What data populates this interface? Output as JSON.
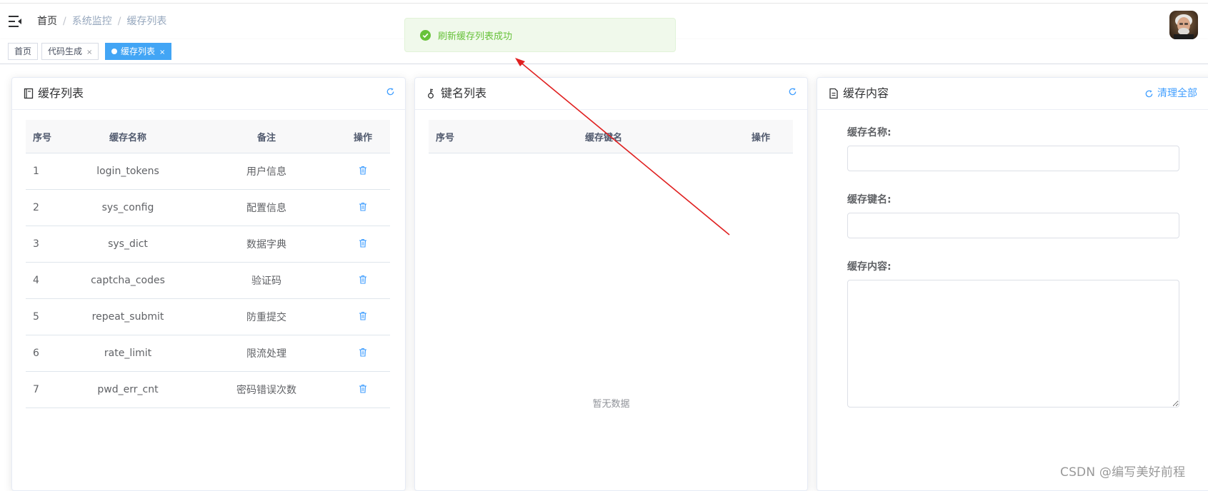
{
  "navbar": {
    "breadcrumb": [
      "首页",
      "系统监控",
      "缓存列表"
    ],
    "breadcrumb_sep": "/"
  },
  "tags": [
    {
      "label": "首页"
    },
    {
      "label": "代码生成",
      "close": "×"
    },
    {
      "label": "缓存列表",
      "close": "×",
      "active": true
    }
  ],
  "toast": {
    "message": "刷新缓存列表成功",
    "type": "success"
  },
  "cache_list": {
    "title": "缓存列表",
    "columns": [
      "序号",
      "缓存名称",
      "备注",
      "操作"
    ],
    "rows": [
      {
        "index": "1",
        "name": "login_tokens",
        "remark": "用户信息"
      },
      {
        "index": "2",
        "name": "sys_config",
        "remark": "配置信息"
      },
      {
        "index": "3",
        "name": "sys_dict",
        "remark": "数据字典"
      },
      {
        "index": "4",
        "name": "captcha_codes",
        "remark": "验证码"
      },
      {
        "index": "5",
        "name": "repeat_submit",
        "remark": "防重提交"
      },
      {
        "index": "6",
        "name": "rate_limit",
        "remark": "限流处理"
      },
      {
        "index": "7",
        "name": "pwd_err_cnt",
        "remark": "密码错误次数"
      }
    ]
  },
  "key_list": {
    "title": "键名列表",
    "columns": [
      "序号",
      "缓存键名",
      "操作"
    ],
    "empty_text": "暂无数据"
  },
  "cache_content": {
    "title": "缓存内容",
    "clear_all_label": "清理全部",
    "fields": {
      "cache_name_label": "缓存名称:",
      "cache_name_value": "",
      "cache_key_label": "缓存键名:",
      "cache_key_value": "",
      "cache_value_label": "缓存内容:",
      "cache_value_value": ""
    }
  },
  "watermark": "CSDN @编写美好前程",
  "colors": {
    "accent": "#409eff",
    "active_tag": "#42a5f5",
    "success": "#67c23a",
    "annotation_arrow": "#e02020"
  }
}
